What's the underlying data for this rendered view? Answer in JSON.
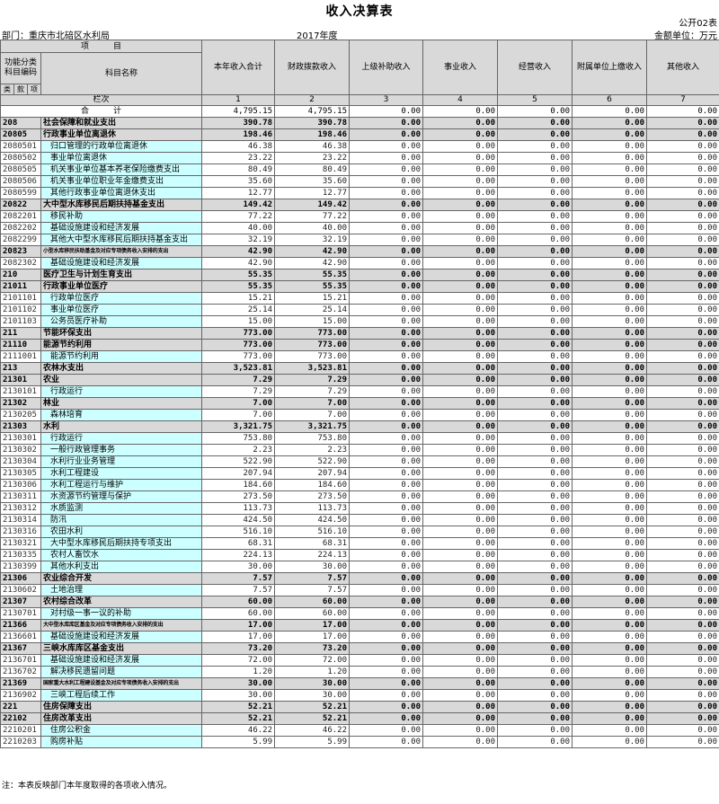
{
  "title": "收入决算表",
  "form_no": "公开02表",
  "dept_label": "部门：重庆市北碚区水利局",
  "year": "2017年度",
  "unit": "金额单位：万元",
  "headers": {
    "item": "项　　　目",
    "func_code": "功能分类科目编码",
    "subject": "科目名称",
    "columns_label": "栏次",
    "total_label": "合　　　计",
    "levels": [
      "类",
      "款",
      "项"
    ],
    "cols": [
      "本年收入合计",
      "财政拨款收入",
      "上级补助收入",
      "事业收入",
      "经营收入",
      "附属单位上缴收入",
      "其他收入"
    ],
    "col_nums": [
      "1",
      "2",
      "3",
      "4",
      "5",
      "6",
      "7"
    ]
  },
  "total": [
    "4,795.15",
    "4,795.15",
    "0.00",
    "0.00",
    "0.00",
    "0.00",
    "0.00"
  ],
  "rows": [
    {
      "code": "208",
      "name": "社会保障和就业支出",
      "lvl": 1,
      "v": [
        "390.78",
        "390.78",
        "0.00",
        "0.00",
        "0.00",
        "0.00",
        "0.00"
      ]
    },
    {
      "code": "20805",
      "name": "行政事业单位离退休",
      "lvl": 2,
      "v": [
        "198.46",
        "198.46",
        "0.00",
        "0.00",
        "0.00",
        "0.00",
        "0.00"
      ]
    },
    {
      "code": "2080501",
      "name": "归口管理的行政单位离退休",
      "lvl": 3,
      "v": [
        "46.38",
        "46.38",
        "0.00",
        "0.00",
        "0.00",
        "0.00",
        "0.00"
      ]
    },
    {
      "code": "2080502",
      "name": "事业单位离退休",
      "lvl": 3,
      "v": [
        "23.22",
        "23.22",
        "0.00",
        "0.00",
        "0.00",
        "0.00",
        "0.00"
      ]
    },
    {
      "code": "2080505",
      "name": "机关事业单位基本养老保险缴费支出",
      "lvl": 3,
      "v": [
        "80.49",
        "80.49",
        "0.00",
        "0.00",
        "0.00",
        "0.00",
        "0.00"
      ]
    },
    {
      "code": "2080506",
      "name": "机关事业单位职业年金缴费支出",
      "lvl": 3,
      "v": [
        "35.60",
        "35.60",
        "0.00",
        "0.00",
        "0.00",
        "0.00",
        "0.00"
      ]
    },
    {
      "code": "2080599",
      "name": "其他行政事业单位离退休支出",
      "lvl": 3,
      "v": [
        "12.77",
        "12.77",
        "0.00",
        "0.00",
        "0.00",
        "0.00",
        "0.00"
      ]
    },
    {
      "code": "20822",
      "name": "大中型水库移民后期扶持基金支出",
      "lvl": 2,
      "v": [
        "149.42",
        "149.42",
        "0.00",
        "0.00",
        "0.00",
        "0.00",
        "0.00"
      ]
    },
    {
      "code": "2082201",
      "name": "移民补助",
      "lvl": 3,
      "v": [
        "77.22",
        "77.22",
        "0.00",
        "0.00",
        "0.00",
        "0.00",
        "0.00"
      ]
    },
    {
      "code": "2082202",
      "name": "基础设施建设和经济发展",
      "lvl": 3,
      "v": [
        "40.00",
        "40.00",
        "0.00",
        "0.00",
        "0.00",
        "0.00",
        "0.00"
      ]
    },
    {
      "code": "2082299",
      "name": "其他大中型水库移民后期扶持基金支出",
      "lvl": 3,
      "v": [
        "32.19",
        "32.19",
        "0.00",
        "0.00",
        "0.00",
        "0.00",
        "0.00"
      ]
    },
    {
      "code": "20823",
      "name": "小型水库移民扶助基金及对应专项债务收入安排的支出",
      "lvl": 2,
      "small": true,
      "v": [
        "42.90",
        "42.90",
        "0.00",
        "0.00",
        "0.00",
        "0.00",
        "0.00"
      ]
    },
    {
      "code": "2082302",
      "name": "基础设施建设和经济发展",
      "lvl": 3,
      "v": [
        "42.90",
        "42.90",
        "0.00",
        "0.00",
        "0.00",
        "0.00",
        "0.00"
      ]
    },
    {
      "code": "210",
      "name": "医疗卫生与计划生育支出",
      "lvl": 1,
      "v": [
        "55.35",
        "55.35",
        "0.00",
        "0.00",
        "0.00",
        "0.00",
        "0.00"
      ]
    },
    {
      "code": "21011",
      "name": "行政事业单位医疗",
      "lvl": 2,
      "v": [
        "55.35",
        "55.35",
        "0.00",
        "0.00",
        "0.00",
        "0.00",
        "0.00"
      ]
    },
    {
      "code": "2101101",
      "name": "行政单位医疗",
      "lvl": 3,
      "v": [
        "15.21",
        "15.21",
        "0.00",
        "0.00",
        "0.00",
        "0.00",
        "0.00"
      ]
    },
    {
      "code": "2101102",
      "name": "事业单位医疗",
      "lvl": 3,
      "v": [
        "25.14",
        "25.14",
        "0.00",
        "0.00",
        "0.00",
        "0.00",
        "0.00"
      ]
    },
    {
      "code": "2101103",
      "name": "公务员医疗补助",
      "lvl": 3,
      "v": [
        "15.00",
        "15.00",
        "0.00",
        "0.00",
        "0.00",
        "0.00",
        "0.00"
      ]
    },
    {
      "code": "211",
      "name": "节能环保支出",
      "lvl": 1,
      "v": [
        "773.00",
        "773.00",
        "0.00",
        "0.00",
        "0.00",
        "0.00",
        "0.00"
      ]
    },
    {
      "code": "21110",
      "name": "能源节约利用",
      "lvl": 2,
      "v": [
        "773.00",
        "773.00",
        "0.00",
        "0.00",
        "0.00",
        "0.00",
        "0.00"
      ]
    },
    {
      "code": "2111001",
      "name": "能源节约利用",
      "lvl": 3,
      "v": [
        "773.00",
        "773.00",
        "0.00",
        "0.00",
        "0.00",
        "0.00",
        "0.00"
      ]
    },
    {
      "code": "213",
      "name": "农林水支出",
      "lvl": 1,
      "v": [
        "3,523.81",
        "3,523.81",
        "0.00",
        "0.00",
        "0.00",
        "0.00",
        "0.00"
      ]
    },
    {
      "code": "21301",
      "name": "农业",
      "lvl": 2,
      "v": [
        "7.29",
        "7.29",
        "0.00",
        "0.00",
        "0.00",
        "0.00",
        "0.00"
      ]
    },
    {
      "code": "2130101",
      "name": "行政运行",
      "lvl": 3,
      "v": [
        "7.29",
        "7.29",
        "0.00",
        "0.00",
        "0.00",
        "0.00",
        "0.00"
      ]
    },
    {
      "code": "21302",
      "name": "林业",
      "lvl": 2,
      "v": [
        "7.00",
        "7.00",
        "0.00",
        "0.00",
        "0.00",
        "0.00",
        "0.00"
      ]
    },
    {
      "code": "2130205",
      "name": "森林培育",
      "lvl": 3,
      "v": [
        "7.00",
        "7.00",
        "0.00",
        "0.00",
        "0.00",
        "0.00",
        "0.00"
      ]
    },
    {
      "code": "21303",
      "name": "水利",
      "lvl": 2,
      "v": [
        "3,321.75",
        "3,321.75",
        "0.00",
        "0.00",
        "0.00",
        "0.00",
        "0.00"
      ]
    },
    {
      "code": "2130301",
      "name": "行政运行",
      "lvl": 3,
      "v": [
        "753.80",
        "753.80",
        "0.00",
        "0.00",
        "0.00",
        "0.00",
        "0.00"
      ]
    },
    {
      "code": "2130302",
      "name": "一般行政管理事务",
      "lvl": 3,
      "v": [
        "2.23",
        "2.23",
        "0.00",
        "0.00",
        "0.00",
        "0.00",
        "0.00"
      ]
    },
    {
      "code": "2130304",
      "name": "水利行业业务管理",
      "lvl": 3,
      "v": [
        "522.90",
        "522.90",
        "0.00",
        "0.00",
        "0.00",
        "0.00",
        "0.00"
      ]
    },
    {
      "code": "2130305",
      "name": "水利工程建设",
      "lvl": 3,
      "v": [
        "207.94",
        "207.94",
        "0.00",
        "0.00",
        "0.00",
        "0.00",
        "0.00"
      ]
    },
    {
      "code": "2130306",
      "name": "水利工程运行与维护",
      "lvl": 3,
      "v": [
        "184.60",
        "184.60",
        "0.00",
        "0.00",
        "0.00",
        "0.00",
        "0.00"
      ]
    },
    {
      "code": "2130311",
      "name": "水资源节约管理与保护",
      "lvl": 3,
      "v": [
        "273.50",
        "273.50",
        "0.00",
        "0.00",
        "0.00",
        "0.00",
        "0.00"
      ]
    },
    {
      "code": "2130312",
      "name": "水质监测",
      "lvl": 3,
      "v": [
        "113.73",
        "113.73",
        "0.00",
        "0.00",
        "0.00",
        "0.00",
        "0.00"
      ]
    },
    {
      "code": "2130314",
      "name": "防汛",
      "lvl": 3,
      "v": [
        "424.50",
        "424.50",
        "0.00",
        "0.00",
        "0.00",
        "0.00",
        "0.00"
      ]
    },
    {
      "code": "2130316",
      "name": "农田水利",
      "lvl": 3,
      "v": [
        "516.10",
        "516.10",
        "0.00",
        "0.00",
        "0.00",
        "0.00",
        "0.00"
      ]
    },
    {
      "code": "2130321",
      "name": "大中型水库移民后期扶持专项支出",
      "lvl": 3,
      "v": [
        "68.31",
        "68.31",
        "0.00",
        "0.00",
        "0.00",
        "0.00",
        "0.00"
      ]
    },
    {
      "code": "2130335",
      "name": "农村人畜饮水",
      "lvl": 3,
      "v": [
        "224.13",
        "224.13",
        "0.00",
        "0.00",
        "0.00",
        "0.00",
        "0.00"
      ]
    },
    {
      "code": "2130399",
      "name": "其他水利支出",
      "lvl": 3,
      "v": [
        "30.00",
        "30.00",
        "0.00",
        "0.00",
        "0.00",
        "0.00",
        "0.00"
      ]
    },
    {
      "code": "21306",
      "name": "农业综合开发",
      "lvl": 2,
      "v": [
        "7.57",
        "7.57",
        "0.00",
        "0.00",
        "0.00",
        "0.00",
        "0.00"
      ]
    },
    {
      "code": "2130602",
      "name": "土地治理",
      "lvl": 3,
      "v": [
        "7.57",
        "7.57",
        "0.00",
        "0.00",
        "0.00",
        "0.00",
        "0.00"
      ]
    },
    {
      "code": "21307",
      "name": "农村综合改革",
      "lvl": 2,
      "v": [
        "60.00",
        "60.00",
        "0.00",
        "0.00",
        "0.00",
        "0.00",
        "0.00"
      ]
    },
    {
      "code": "2130701",
      "name": "对村级一事一议的补助",
      "lvl": 3,
      "v": [
        "60.00",
        "60.00",
        "0.00",
        "0.00",
        "0.00",
        "0.00",
        "0.00"
      ]
    },
    {
      "code": "21366",
      "name": "大中型水库库区基金及对应专项债务收入安排的支出",
      "lvl": 2,
      "small": true,
      "v": [
        "17.00",
        "17.00",
        "0.00",
        "0.00",
        "0.00",
        "0.00",
        "0.00"
      ]
    },
    {
      "code": "2136601",
      "name": "基础设施建设和经济发展",
      "lvl": 3,
      "v": [
        "17.00",
        "17.00",
        "0.00",
        "0.00",
        "0.00",
        "0.00",
        "0.00"
      ]
    },
    {
      "code": "21367",
      "name": "三峡水库库区基金支出",
      "lvl": 2,
      "v": [
        "73.20",
        "73.20",
        "0.00",
        "0.00",
        "0.00",
        "0.00",
        "0.00"
      ]
    },
    {
      "code": "2136701",
      "name": "基础设施建设和经济发展",
      "lvl": 3,
      "v": [
        "72.00",
        "72.00",
        "0.00",
        "0.00",
        "0.00",
        "0.00",
        "0.00"
      ]
    },
    {
      "code": "2136702",
      "name": "解决移民遗留问题",
      "lvl": 3,
      "v": [
        "1.20",
        "1.20",
        "0.00",
        "0.00",
        "0.00",
        "0.00",
        "0.00"
      ]
    },
    {
      "code": "21369",
      "name": "国家重大水利工程建设基金及对应专项债务收入安排的支出",
      "lvl": 2,
      "small": true,
      "v": [
        "30.00",
        "30.00",
        "0.00",
        "0.00",
        "0.00",
        "0.00",
        "0.00"
      ]
    },
    {
      "code": "2136902",
      "name": "三峡工程后续工作",
      "lvl": 3,
      "v": [
        "30.00",
        "30.00",
        "0.00",
        "0.00",
        "0.00",
        "0.00",
        "0.00"
      ]
    },
    {
      "code": "221",
      "name": "住房保障支出",
      "lvl": 1,
      "v": [
        "52.21",
        "52.21",
        "0.00",
        "0.00",
        "0.00",
        "0.00",
        "0.00"
      ]
    },
    {
      "code": "22102",
      "name": "住房改革支出",
      "lvl": 2,
      "v": [
        "52.21",
        "52.21",
        "0.00",
        "0.00",
        "0.00",
        "0.00",
        "0.00"
      ]
    },
    {
      "code": "2210201",
      "name": "住房公积金",
      "lvl": 3,
      "v": [
        "46.22",
        "46.22",
        "0.00",
        "0.00",
        "0.00",
        "0.00",
        "0.00"
      ]
    },
    {
      "code": "2210203",
      "name": "购房补贴",
      "lvl": 3,
      "v": [
        "5.99",
        "5.99",
        "0.00",
        "0.00",
        "0.00",
        "0.00",
        "0.00"
      ]
    }
  ],
  "note": "注：本表反映部门本年度取得的各项收入情况。"
}
